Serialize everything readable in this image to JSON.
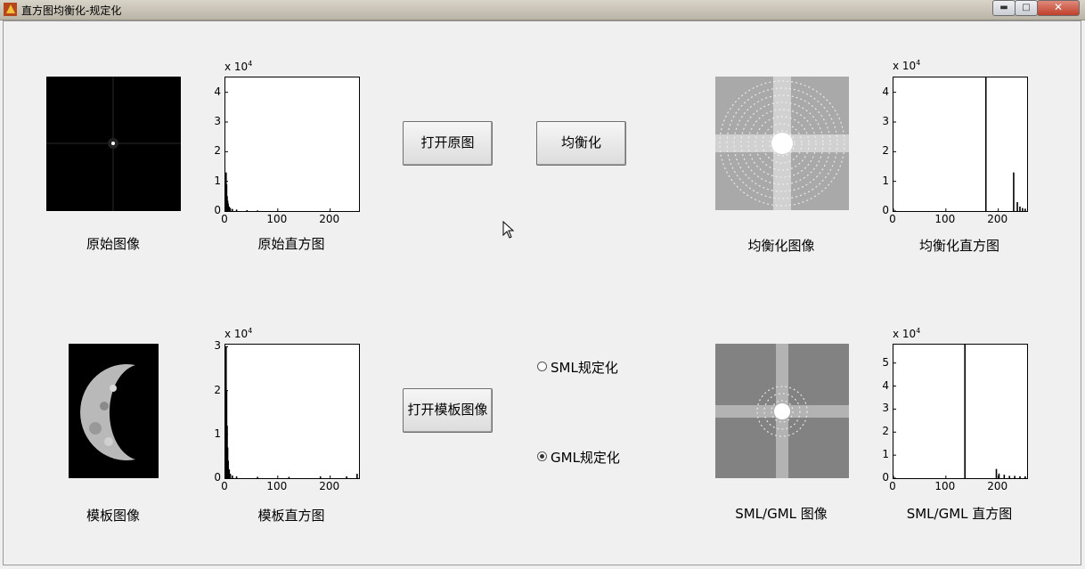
{
  "window": {
    "title": "直方图均衡化-规定化",
    "min_icon": "minimize-icon",
    "max_icon": "maximize-icon",
    "close_icon": "close-icon",
    "app_icon": "matlab-icon"
  },
  "exponent": {
    "base": "x 10",
    "power": "4"
  },
  "x_ticks": [
    "0",
    "100",
    "200"
  ],
  "captions": {
    "original_image": "原始图像",
    "original_hist": "原始直方图",
    "equalized_image": "均衡化图像",
    "equalized_hist": "均衡化直方图",
    "template_image": "模板图像",
    "template_hist": "模板直方图",
    "sml_image": "SML/GML 图像",
    "sml_hist": "SML/GML 直方图"
  },
  "buttons": {
    "open_original": "打开原图",
    "equalize": "均衡化",
    "open_template": "打开模板图像"
  },
  "radios": {
    "sml": {
      "label": "SML规定化",
      "checked": false
    },
    "gml": {
      "label": "GML规定化",
      "checked": true
    }
  },
  "chart_data": [
    {
      "name": "原始直方图",
      "type": "bar",
      "xlim": [
        0,
        255
      ],
      "ylim": [
        0,
        4.5
      ],
      "y_scale_exponent": 4,
      "yticks": [
        "0",
        "1",
        "2",
        "3",
        "4"
      ],
      "x": [
        0,
        1,
        2,
        3,
        4,
        6,
        8,
        12,
        20,
        40,
        60
      ],
      "values": [
        1.3,
        0.9,
        0.5,
        0.35,
        0.25,
        0.15,
        0.1,
        0.07,
        0.05,
        0.03,
        0.02
      ]
    },
    {
      "name": "均衡化直方图",
      "type": "bar",
      "xlim": [
        0,
        255
      ],
      "ylim": [
        0,
        4.5
      ],
      "y_scale_exponent": 4,
      "yticks": [
        "0",
        "1",
        "2",
        "3",
        "4"
      ],
      "x": [
        175,
        228,
        235,
        240,
        245,
        250
      ],
      "values": [
        4.5,
        1.3,
        0.3,
        0.15,
        0.1,
        0.08
      ]
    },
    {
      "name": "模板直方图",
      "type": "bar",
      "xlim": [
        0,
        255
      ],
      "ylim": [
        0,
        3.05
      ],
      "y_scale_exponent": 4,
      "yticks": [
        "0",
        "1",
        "2",
        "3"
      ],
      "x": [
        0,
        1,
        2,
        3,
        4,
        6,
        8,
        12,
        20,
        60,
        120,
        180,
        230,
        250
      ],
      "values": [
        3.0,
        2.0,
        1.2,
        0.7,
        0.4,
        0.2,
        0.1,
        0.06,
        0.04,
        0.03,
        0.03,
        0.04,
        0.04,
        0.1
      ]
    },
    {
      "name": "SML/GML 直方图",
      "type": "bar",
      "xlim": [
        0,
        255
      ],
      "ylim": [
        0,
        5.8
      ],
      "y_scale_exponent": 4,
      "yticks": [
        "0",
        "1",
        "2",
        "3",
        "4",
        "5"
      ],
      "x": [
        135,
        195,
        200,
        210,
        220,
        230,
        240,
        250
      ],
      "values": [
        5.8,
        0.4,
        0.2,
        0.15,
        0.1,
        0.1,
        0.08,
        0.08
      ]
    }
  ]
}
